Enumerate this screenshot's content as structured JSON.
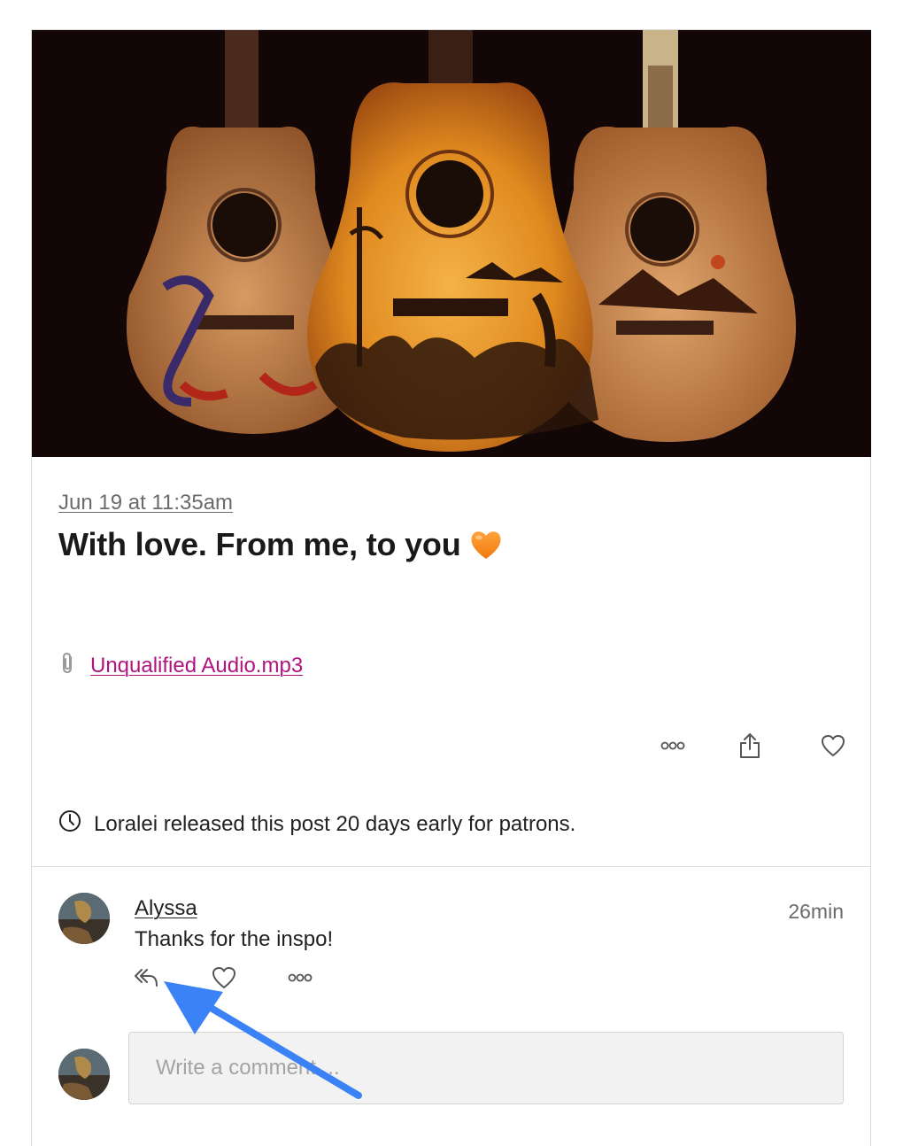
{
  "post": {
    "date": "Jun 19 at 11:35am",
    "title": "With love. From me, to you",
    "title_emoji": "orange-heart",
    "attachment": {
      "icon": "paperclip-icon",
      "filename": "Unqualified Audio.mp3"
    },
    "actions": {
      "more_icon": "more-dots-icon",
      "share_icon": "share-icon",
      "like_icon": "heart-icon"
    },
    "early_release_text": "Loralei released this post 20 days early for patrons."
  },
  "comment": {
    "author": "Alyssa",
    "time": "26min",
    "text": "Thanks for the inspo!",
    "actions": {
      "reply_icon": "reply-icon",
      "like_icon": "heart-icon",
      "more_icon": "more-dots-icon"
    }
  },
  "composer": {
    "placeholder": "Write a comment ..."
  },
  "colors": {
    "link": "#b0147e",
    "annotation_arrow": "#3b82f6",
    "hero_background": "#120606"
  }
}
